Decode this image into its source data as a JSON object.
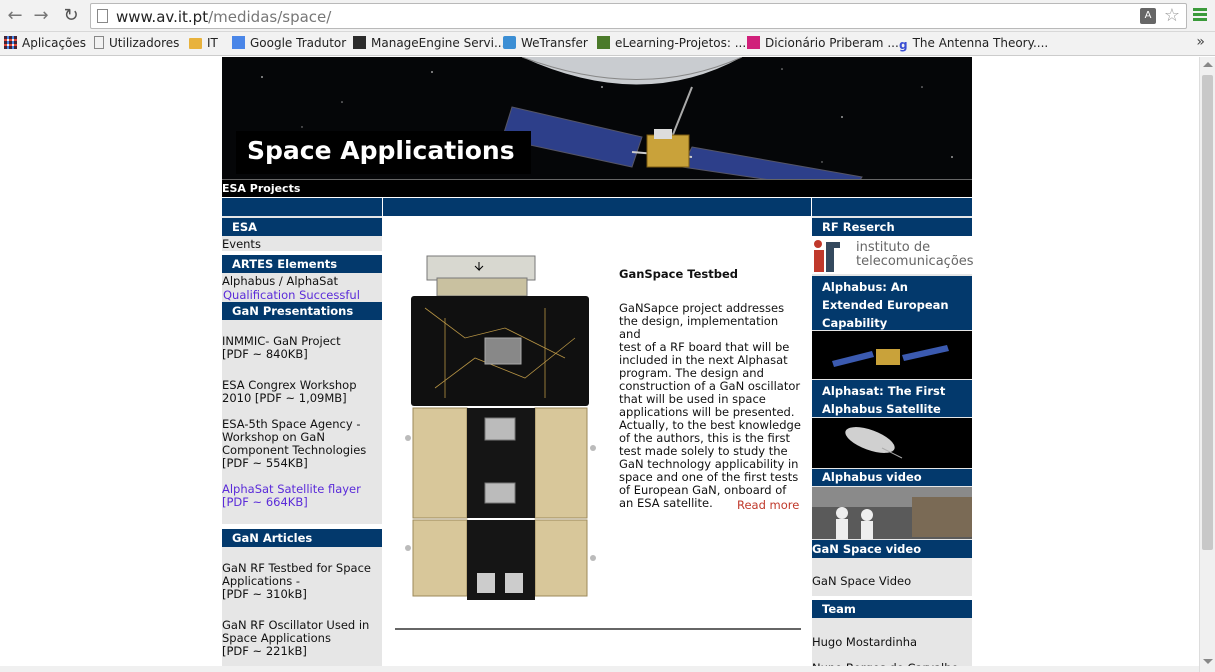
{
  "browser": {
    "url_host": "www.av.it.pt",
    "url_path": "/medidas/space/",
    "bookmarks": [
      {
        "label": "Aplicações",
        "icon": "apps-grid-icon",
        "color": "#e0443a"
      },
      {
        "label": "Utilizadores",
        "icon": "page-icon",
        "color": "#888888"
      },
      {
        "label": "IT",
        "icon": "folder-icon",
        "color": "#e8b23c"
      },
      {
        "label": "Google Tradutor",
        "icon": "google-translate-icon",
        "color": "#4a86e8"
      },
      {
        "label": "ManageEngine Servi...",
        "icon": "manageengine-icon",
        "color": "#2b2b2b"
      },
      {
        "label": "WeTransfer",
        "icon": "wetransfer-icon",
        "color": "#3b8ed4"
      },
      {
        "label": "eLearning-Projetos: ...",
        "icon": "elearning-icon",
        "color": "#4b7a2a"
      },
      {
        "label": "Dicionário Priberam ...",
        "icon": "priberam-icon",
        "color": "#d0207a"
      },
      {
        "label": "The Antenna Theory....",
        "icon": "antenna-theory-icon",
        "color": "#3b4fd4"
      }
    ],
    "more_label": "»"
  },
  "banner": {
    "title": "Space Applications",
    "strip_label": "ESA Projects"
  },
  "left": {
    "esa_header": "ESA",
    "events": "Events",
    "artes_header": "ARTES Elements",
    "alphabus": "Alphabus / AlphaSat",
    "qualification": "Qualification Successful",
    "gan_presentations_header": "GaN  Presentations",
    "presentations": [
      {
        "lines": [
          "INMMIC- GaN Project",
          "[PDF ~ 840KB]"
        ],
        "link": false
      },
      {
        "lines": [
          "ESA Congrex Workshop",
          "2010 [PDF ~ 1,09MB]"
        ],
        "link": false
      },
      {
        "lines": [
          "ESA-5th Space Agency -",
          "Workshop on GaN",
          "Component Technologies",
          "[PDF ~ 554KB]"
        ],
        "link": false
      },
      {
        "lines": [
          "AlphaSat Satellite flayer",
          "[PDF ~ 664KB]"
        ],
        "link": true
      }
    ],
    "gan_articles_header": "GaN Articles",
    "articles": [
      {
        "lines": [
          "GaN RF Testbed for Space",
          "Applications -",
          "[PDF ~ 310kB]"
        ]
      },
      {
        "lines": [
          "GaN RF Oscillator Used in",
          "Space Applications",
          "[PDF ~ 221kB]"
        ]
      }
    ]
  },
  "middle": {
    "title": "GanSpace Testbed",
    "body": "GaNSapce project addresses the design, implementation and test of a RF board that will be included in the next Alphasat program. The design and construction of a GaN oscillator that will be used in space applications will be presented. Actually, to the best knowledge of the authors, this is the first test made solely to study the GaN technology applicability in space and one of the first tests of European GaN, onboard of an ESA satellite.",
    "body_lines": [
      "GaNSapce project addresses",
      "the design, implementation and",
      "test of a RF board that will be",
      "included in the next Alphasat",
      "program. The design and",
      "construction of a GaN oscillator",
      "that will be used in space",
      "applications will be presented.",
      "Actually, to the best knowledge",
      "of the authors, this is the first",
      "test made solely to study the",
      "GaN technology applicability in",
      "space and one of the first tests",
      "of European GaN, onboard of",
      "an ESA satellite."
    ],
    "read_more": "Read more"
  },
  "right": {
    "rf_header": "RF Reserch",
    "it_logo_line1": "instituto de",
    "it_logo_line2": "telecomunicações",
    "alphabus_box_lines": [
      "Alphabus: An",
      "Extended European",
      "Capability"
    ],
    "alphasat_box_lines": [
      "Alphasat: The First",
      "Alphabus Satellite"
    ],
    "alphabus_video": "Alphabus video",
    "gan_space_video_header": "GaN Space video",
    "gan_space_video_link": "GaN Space Video",
    "team_header": "Team",
    "team_members": [
      "Hugo Mostardinha",
      "Nuno Borges de Carvalho"
    ]
  },
  "colors": {
    "header_blue": "#03396c",
    "column_gray": "#e6e6e6",
    "link_purple": "#5a2bd9",
    "read_more_red": "#c0392b"
  }
}
